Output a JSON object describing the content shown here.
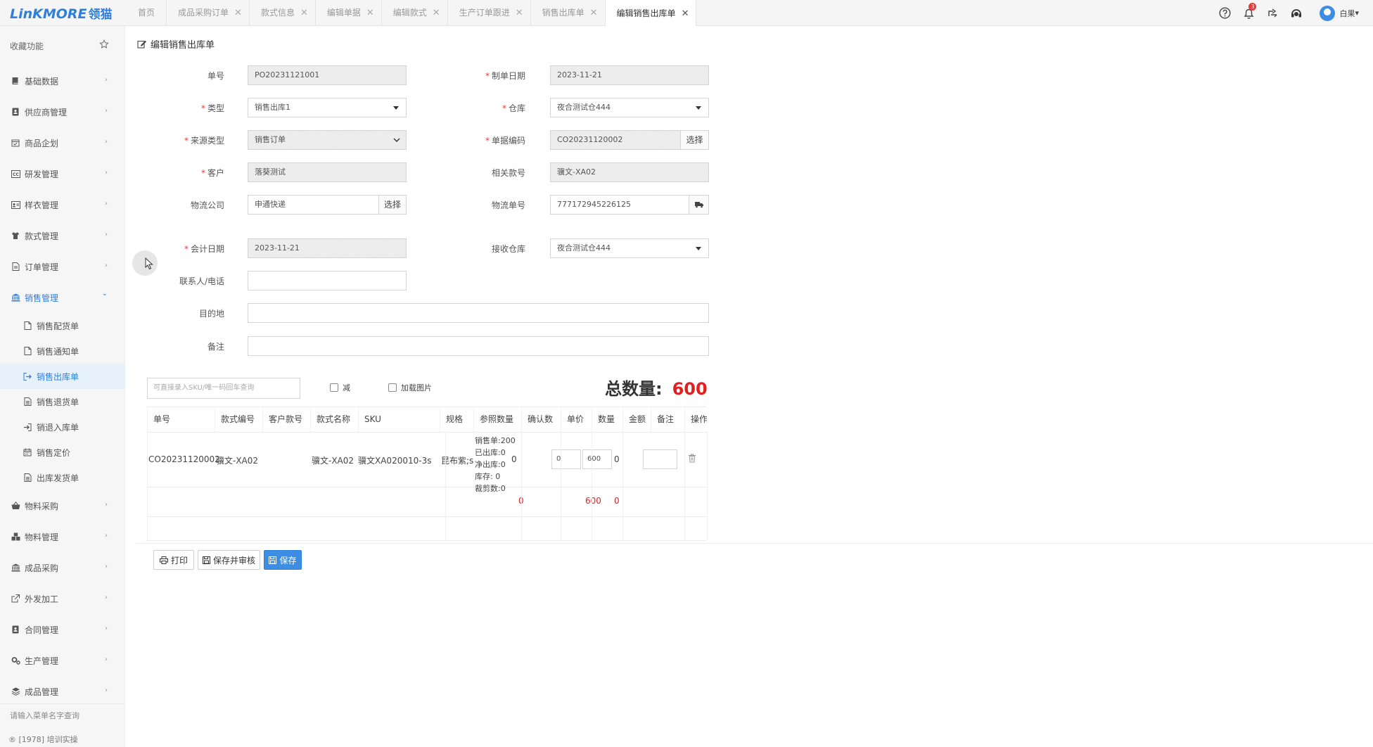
{
  "app": {
    "logo_text": "LinKMORE",
    "logo_cn": "领猫"
  },
  "tabs": [
    {
      "label": "首页",
      "closable": false
    },
    {
      "label": "成品采购订单",
      "closable": true
    },
    {
      "label": "款式信息",
      "closable": true
    },
    {
      "label": "编辑单据",
      "closable": true
    },
    {
      "label": "编辑款式",
      "closable": true
    },
    {
      "label": "生产订单跟进",
      "closable": true
    },
    {
      "label": "销售出库单",
      "closable": true
    },
    {
      "label": "编辑销售出库单",
      "closable": true,
      "active": true
    }
  ],
  "tab_close_glyph": "✕",
  "topbar": {
    "notification_count": "3",
    "user_name": "白果",
    "user_chevron": "▾"
  },
  "sidebar": {
    "favorites_label": "收藏功能",
    "items": [
      {
        "label": "基础数据",
        "icon": "book-icon"
      },
      {
        "label": "供应商管理",
        "icon": "contact-icon"
      },
      {
        "label": "商品企划",
        "icon": "calendar-check-icon"
      },
      {
        "label": "研发管理",
        "icon": "cc-icon"
      },
      {
        "label": "样衣管理",
        "icon": "id-card-icon"
      },
      {
        "label": "款式管理",
        "icon": "shirt-icon"
      },
      {
        "label": "订单管理",
        "icon": "document-icon"
      },
      {
        "label": "销售管理",
        "icon": "bank-icon",
        "open": true
      }
    ],
    "sales_sub": [
      {
        "label": "销售配货单",
        "icon": "file-icon"
      },
      {
        "label": "销售通知单",
        "icon": "file-icon"
      },
      {
        "label": "销售出库单",
        "icon": "sign-out-icon",
        "active": true
      },
      {
        "label": "销售退货单",
        "icon": "file-text-icon"
      },
      {
        "label": "销退入库单",
        "icon": "sign-in-icon"
      },
      {
        "label": "销售定价",
        "icon": "calendar-icon"
      },
      {
        "label": "出库发货单",
        "icon": "file-text-icon"
      }
    ],
    "items_after": [
      {
        "label": "物料采购",
        "icon": "basket-icon"
      },
      {
        "label": "物料管理",
        "icon": "cubes-icon"
      },
      {
        "label": "成品采购",
        "icon": "bank-icon"
      },
      {
        "label": "外发加工",
        "icon": "external-link-icon"
      },
      {
        "label": "合同管理",
        "icon": "contact-icon"
      },
      {
        "label": "生产管理",
        "icon": "cogs-icon"
      },
      {
        "label": "成品管理",
        "icon": "stack-icon"
      }
    ],
    "chevron_right": "›",
    "chevron_down": "⌄",
    "menu_search_placeholder": "请输入菜单名字查询",
    "footer": "[1978] 培训实操"
  },
  "form": {
    "title": "编辑销售出库单",
    "order_no": {
      "label": "单号",
      "value": "PO20231121001"
    },
    "create_date": {
      "label": "制单日期",
      "value": "2023-11-21"
    },
    "type": {
      "label": "类型",
      "value": "销售出库1"
    },
    "warehouse": {
      "label": "仓库",
      "value": "夜合测试仓444"
    },
    "source_type": {
      "label": "来源类型",
      "value": "销售订单"
    },
    "doc_code": {
      "label": "单据编码",
      "value": "CO20231120002",
      "button": "选择"
    },
    "customer": {
      "label": "客户",
      "value": "落葵测试"
    },
    "related_style": {
      "label": "相关款号",
      "value": "骥文-XA02"
    },
    "logistics_company": {
      "label": "物流公司",
      "value": "申通快递",
      "button": "选择"
    },
    "logistics_no": {
      "label": "物流单号",
      "value": "777172945226125"
    },
    "accounting_date": {
      "label": "会计日期",
      "value": "2023-11-21"
    },
    "receive_warehouse": {
      "label": "接收仓库",
      "value": "夜合测试仓444"
    },
    "contact": {
      "label": "联系人/电话",
      "value": ""
    },
    "destination": {
      "label": "目的地",
      "value": ""
    },
    "remark": {
      "label": "备注",
      "value": ""
    },
    "required_mark": "*"
  },
  "toolbar": {
    "sku_placeholder": "可直接录入SKU/唯一码回车查询",
    "minus_label": "减",
    "load_images_label": "加载图片",
    "total_label": "总数量:",
    "total_value": "600"
  },
  "table": {
    "headers": [
      "单号",
      "款式编号",
      "客户款号",
      "款式名称",
      "SKU",
      "规格",
      "参照数量",
      "确认数",
      "单价",
      "数量",
      "金额",
      "备注",
      "操作"
    ],
    "rows": [
      {
        "order_no": "CO20231120002",
        "style_no": "骥文-XA02",
        "customer_style_no": "",
        "style_name": "骥文-XA02",
        "sku": "骥文XA020010-3s",
        "spec": "昆布紫;s",
        "ref_qty_lines": [
          "销售单:200",
          "已出库:0",
          "净出库:0",
          "库存: 0",
          "裁剪数:0"
        ],
        "confirm_qty": "0",
        "unit_price": "0",
        "quantity": "600",
        "amount": "0",
        "remark": ""
      }
    ],
    "totals": {
      "confirm_qty": "0",
      "quantity": "600",
      "amount": "0"
    }
  },
  "footer_buttons": {
    "print": "打印",
    "save_audit": "保存并审核",
    "save": "保存"
  }
}
